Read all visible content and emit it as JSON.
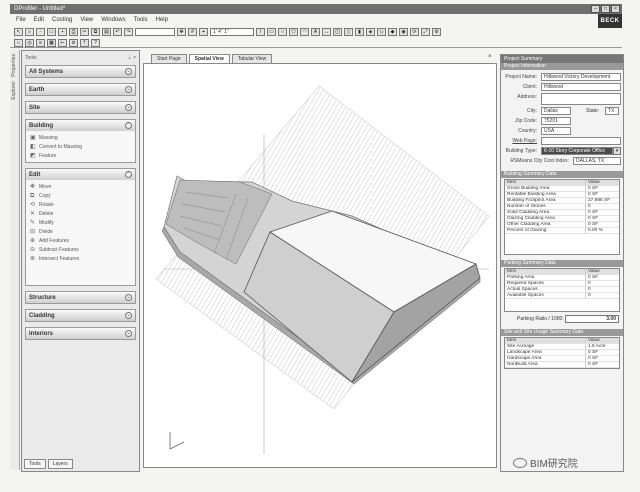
{
  "window": {
    "title": "DProfiler - Untitled*"
  },
  "menu": [
    "File",
    "Edit",
    "Costing",
    "View",
    "Windows",
    "Tools",
    "Help"
  ],
  "logo_text": "BECK",
  "toolbar": {
    "scale_value": "1' 4\" 1\""
  },
  "sidestrip": [
    "Properties",
    "Explorer"
  ],
  "left_panel": {
    "header": "Tools",
    "sections": [
      {
        "title": "All Systems",
        "items": []
      },
      {
        "title": "Earth",
        "items": []
      },
      {
        "title": "Site",
        "items": []
      },
      {
        "title": "Building",
        "items": [
          "Massing",
          "Convert to Massing",
          "Feature"
        ]
      },
      {
        "title": "Edit",
        "items": [
          "Move",
          "Copy",
          "Rotate",
          "Delete",
          "Modify",
          "Divide",
          "Add Features",
          "Subtract Features",
          "Intersect Features"
        ]
      },
      {
        "title": "Structure",
        "items": []
      },
      {
        "title": "Cladding",
        "items": []
      },
      {
        "title": "Interiors",
        "items": []
      }
    ],
    "tabs": [
      "Tools",
      "Layers"
    ]
  },
  "view_tabs": [
    "Start Page",
    "Spatial View",
    "Tabular View"
  ],
  "active_view_tab": "Spatial View",
  "right_panel": {
    "title": "Project Summary",
    "project_info_title": "Project Information",
    "project_name_label": "Project Name:",
    "project_name": "Hillwood Victory Development",
    "client_label": "Client:",
    "client": "Hillwood",
    "address_label": "Address:",
    "address": "",
    "city_label": "City:",
    "city": "Dallas",
    "state_label": "State:",
    "state": "TX",
    "zip_label": "Zip Code:",
    "zip": "75201",
    "country_label": "Country:",
    "country": "USA",
    "web_label": "Web Page:",
    "web": "",
    "building_type_label": "Building Type:",
    "building_type": "6-10 Story Corporate Office",
    "rs_label": "RSMeans City Cost Index:",
    "rs_value": "DALLAS, TX",
    "building_summary_title": "Building Summary Data",
    "building_summary": {
      "header": [
        "Item",
        "Value"
      ],
      "rows": [
        [
          "Gross Building Area",
          "0 SF"
        ],
        [
          "Rentable Building Area",
          "0 SF"
        ],
        [
          "Building Footprint Area",
          "27,986 SF"
        ],
        [
          "Number of Stories",
          "0"
        ],
        [
          "Solid Cladding Area",
          "0 SF"
        ],
        [
          "Glazing Cladding Area",
          "0 SF"
        ],
        [
          "Other Cladding Area",
          "0 SF"
        ],
        [
          "Percent of Glazing",
          "0.00 %"
        ]
      ]
    },
    "parking_title": "Parking Summary Data",
    "parking": {
      "header": [
        "Item",
        "Value"
      ],
      "rows": [
        [
          "Parking Area",
          "0 SF"
        ],
        [
          "Required Spaces",
          "0"
        ],
        [
          "Actual Spaces",
          "0"
        ],
        [
          "Available Spaces",
          "0"
        ]
      ]
    },
    "parking_ratio_label": "Parking Ratio / 1000:",
    "parking_ratio": "3.00",
    "site_title": "Site and Site Usage Summary Data",
    "site": {
      "header": [
        "Item",
        "Value"
      ],
      "rows": [
        [
          "Site Acreage",
          "1.6 Acre"
        ],
        [
          "Landscape Area",
          "0 SF"
        ],
        [
          "Hardscape Area",
          "0 SF"
        ],
        [
          "NonBuild Area",
          "0 SF"
        ]
      ]
    }
  },
  "watermark": "BIM研究院"
}
